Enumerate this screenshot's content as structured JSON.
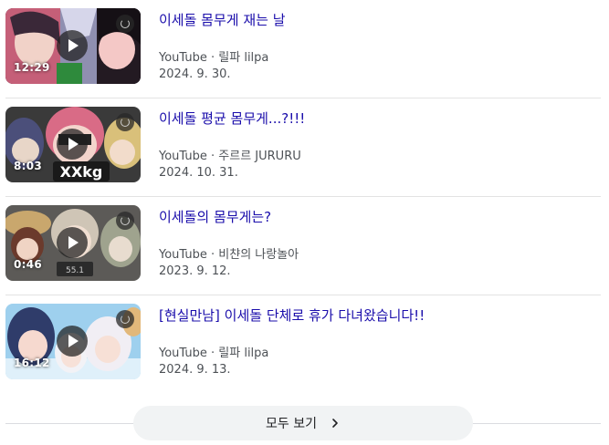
{
  "videos": [
    {
      "title": "이세돌 몸무게 재는 날",
      "source": "YouTube",
      "channel": "릴파 lilpa",
      "date": "2024. 9. 30.",
      "duration": "12:29"
    },
    {
      "title": "이세돌 평균 몸무게...?!!!",
      "source": "YouTube",
      "channel": "주르르 JURURU",
      "date": "2024. 10. 31.",
      "duration": "8:03",
      "thumb_text": "XXkg"
    },
    {
      "title": "이세돌의 몸무게는?",
      "source": "YouTube",
      "channel": "비챤의 나랑놀아",
      "date": "2023. 9. 12.",
      "duration": "0:46",
      "thumb_text": "55.1"
    },
    {
      "title": "[현실만남] 이세돌 단체로 휴가 다녀왔습니다!!",
      "source": "YouTube",
      "channel": "릴파 lilpa",
      "date": "2024. 9. 13.",
      "duration": "16:12"
    }
  ],
  "separator": " · ",
  "more_button": {
    "label": "모두 보기",
    "icon": "chevron-right-icon"
  },
  "colors": {
    "title_link": "#1a0dab",
    "meta_text": "#4d5156",
    "button_bg": "#f1f3f4"
  }
}
